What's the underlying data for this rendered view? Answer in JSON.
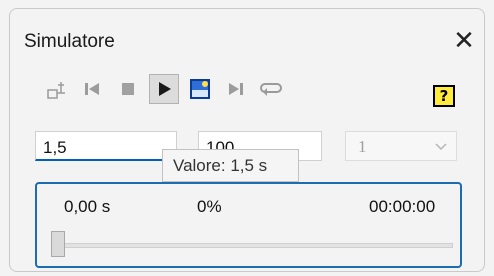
{
  "window": {
    "title": "Simulatore",
    "close_icon": "close-icon"
  },
  "toolbar": {
    "buttons": [
      {
        "name": "mechanism-icon"
      },
      {
        "name": "rewind-to-start-icon"
      },
      {
        "name": "stop-icon"
      },
      {
        "name": "play-icon",
        "active": true
      },
      {
        "name": "render-image-icon"
      },
      {
        "name": "skip-to-end-icon"
      },
      {
        "name": "loop-icon"
      }
    ],
    "help_label": "?"
  },
  "inputs": {
    "value": "1,5",
    "steps": "100",
    "repeat_selected": "1"
  },
  "tooltip": "Valore: 1,5 s",
  "status": {
    "time": "0,00 s",
    "percent": "0%",
    "clock": "00:00:00"
  },
  "slider": {
    "position_fraction": 0
  },
  "colors": {
    "accent": "#005fb8",
    "panel_border": "#1b6cb0",
    "help_bg": "#ffeb3b"
  }
}
